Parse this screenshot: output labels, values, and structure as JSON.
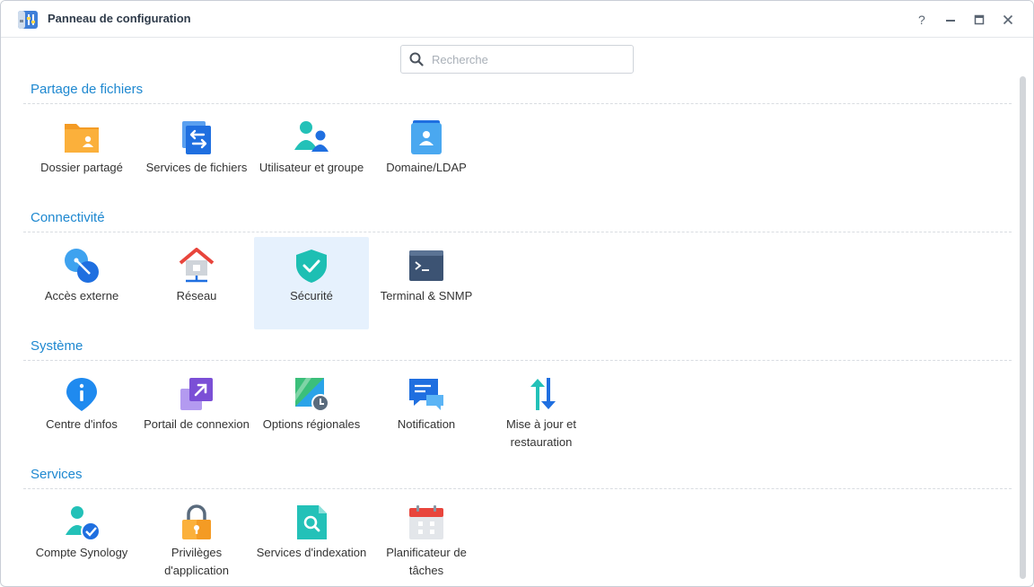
{
  "window": {
    "title": "Panneau de configuration"
  },
  "search": {
    "placeholder": "Recherche"
  },
  "sections": [
    {
      "title": "Partage de fichiers",
      "items": [
        {
          "label": "Dossier partagé",
          "icon": "shared-folder-icon"
        },
        {
          "label": "Services de fichiers",
          "icon": "file-services-icon"
        },
        {
          "label": "Utilisateur et groupe",
          "icon": "user-group-icon"
        },
        {
          "label": "Domaine/LDAP",
          "icon": "domain-ldap-icon"
        }
      ]
    },
    {
      "title": "Connectivité",
      "items": [
        {
          "label": "Accès externe",
          "icon": "external-access-icon"
        },
        {
          "label": "Réseau",
          "icon": "network-icon"
        },
        {
          "label": "Sécurité",
          "icon": "security-shield-icon",
          "selected": true
        },
        {
          "label": "Terminal & SNMP",
          "icon": "terminal-icon"
        }
      ]
    },
    {
      "title": "Système",
      "items": [
        {
          "label": "Centre d'infos",
          "icon": "info-center-icon"
        },
        {
          "label": "Portail de connexion",
          "icon": "login-portal-icon"
        },
        {
          "label": "Options régionales",
          "icon": "regional-options-icon"
        },
        {
          "label": "Notification",
          "icon": "notification-icon"
        },
        {
          "label": "Mise à jour et restauration",
          "icon": "update-restore-icon"
        }
      ]
    },
    {
      "title": "Services",
      "items": [
        {
          "label": "Compte Synology",
          "icon": "synology-account-icon"
        },
        {
          "label": "Privilèges d'application",
          "icon": "app-privileges-icon"
        },
        {
          "label": "Services d'indexation",
          "icon": "indexing-service-icon"
        },
        {
          "label": "Planificateur de tâches",
          "icon": "task-scheduler-icon"
        }
      ]
    }
  ],
  "colors": {
    "accent": "#1e88d0",
    "selected_bg": "#e6f1fd"
  }
}
